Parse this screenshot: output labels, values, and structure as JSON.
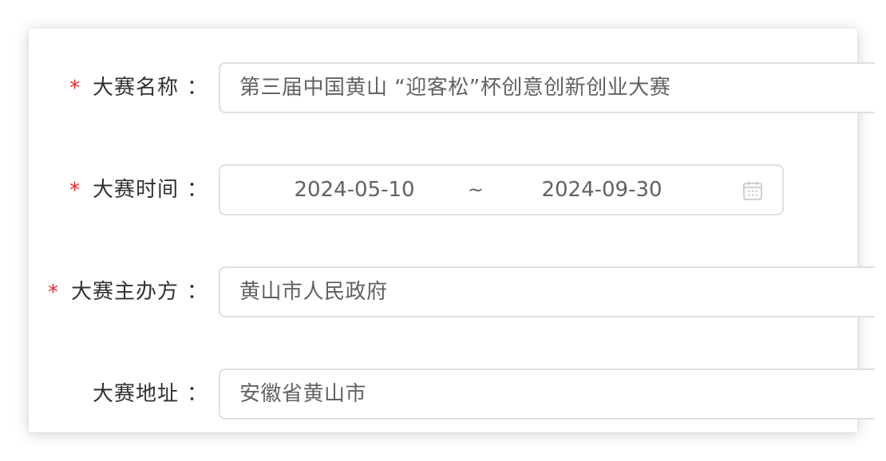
{
  "form": {
    "fields": [
      {
        "label": "大赛名称",
        "required": true,
        "colon": "：",
        "value": "第三届中国黄山 “迎客松”杯创意创新创业大赛"
      },
      {
        "label": "大赛时间",
        "required": true,
        "colon": "：",
        "range_start": "2024-05-10",
        "range_separator": "~",
        "range_end": "2024-09-30",
        "icon": "calendar-icon"
      },
      {
        "label": "大赛主办方",
        "required": true,
        "colon": "：",
        "value": "黄山市人民政府"
      },
      {
        "label": "大赛地址",
        "required": false,
        "colon": "：",
        "value": "安徽省黄山市"
      }
    ],
    "required_mark": "*"
  },
  "colors": {
    "required": "#f5222d",
    "label": "#303133",
    "input_text": "#606266",
    "border": "#dcdfe6"
  }
}
